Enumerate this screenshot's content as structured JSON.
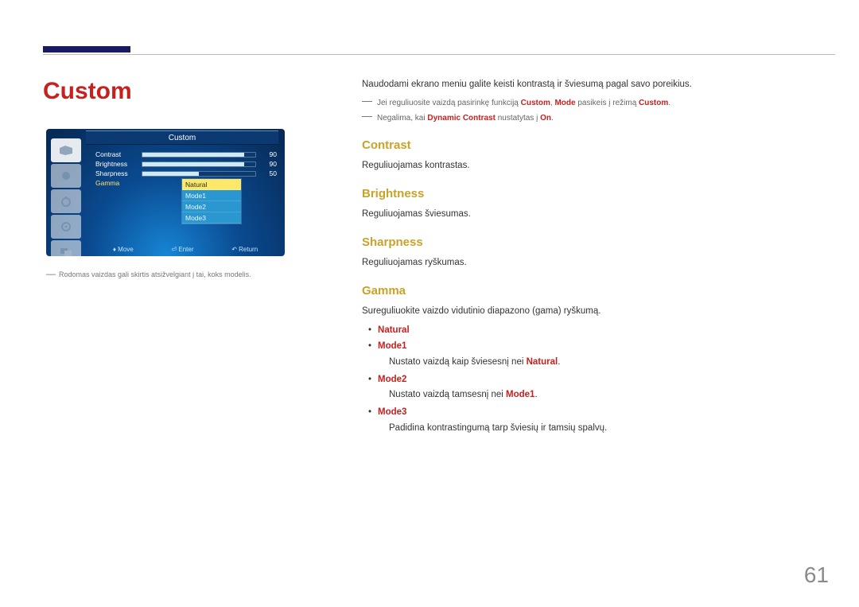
{
  "page": {
    "number": "61"
  },
  "title": "Custom",
  "osd": {
    "title": "Custom",
    "rows": {
      "contrast": {
        "label": "Contrast",
        "value": "90",
        "fill": "90%"
      },
      "brightness": {
        "label": "Brightness",
        "value": "90",
        "fill": "90%"
      },
      "sharpness": {
        "label": "Sharpness",
        "value": "50",
        "fill": "50%"
      },
      "gamma": {
        "label": "Gamma"
      }
    },
    "options": [
      "Natural",
      "Mode1",
      "Mode2",
      "Mode3"
    ],
    "footer": {
      "move": "Move",
      "enter": "Enter",
      "return": "Return"
    }
  },
  "left_note": "Rodomas vaizdas gali skirtis atsižvelgiant į tai, koks modelis.",
  "intro": "Naudodami ekrano meniu galite keisti kontrastą ir šviesumą pagal savo poreikius.",
  "dash1": {
    "pre": "Jei reguliuosite vaizdą pasirinkę funkciją ",
    "hl1": "Custom",
    "mid1": ", ",
    "hl2": "Mode",
    "mid2": " pasikeis į režimą ",
    "hl3": "Custom",
    "post": "."
  },
  "dash2": {
    "pre": "Negalima, kai ",
    "hl1": "Dynamic Contrast",
    "mid1": " nustatytas į ",
    "hl2": "On",
    "post": "."
  },
  "sections": {
    "contrast": {
      "head": "Contrast",
      "body": "Reguliuojamas kontrastas."
    },
    "brightness": {
      "head": "Brightness",
      "body": "Reguliuojamas šviesumas."
    },
    "sharpness": {
      "head": "Sharpness",
      "body": "Reguliuojamas ryškumas."
    },
    "gamma": {
      "head": "Gamma",
      "body": "Sureguliuokite vaizdo vidutinio diapazono (gama) ryškumą.",
      "items": {
        "natural": {
          "label": "Natural"
        },
        "mode1": {
          "label": "Mode1",
          "desc_pre": "Nustato vaizdą kaip šviesesnį nei ",
          "desc_hl": "Natural",
          "desc_post": "."
        },
        "mode2": {
          "label": "Mode2",
          "desc_pre": "Nustato vaizdą tamsesnį nei ",
          "desc_hl": "Mode1",
          "desc_post": "."
        },
        "mode3": {
          "label": "Mode3",
          "desc": "Padidina kontrastingumą tarp šviesių ir tamsių spalvų."
        }
      }
    }
  }
}
